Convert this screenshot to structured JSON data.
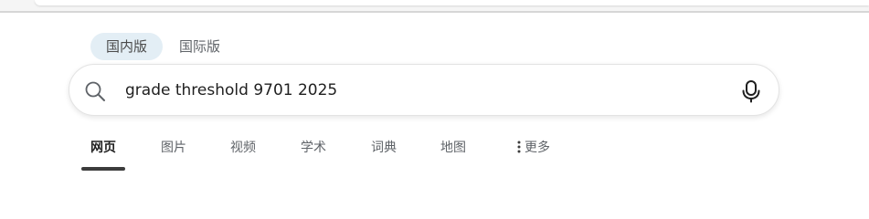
{
  "region_tabs": {
    "domestic_label": "国内版",
    "international_label": "国际版"
  },
  "search": {
    "value": "grade threshold 9701 2025",
    "placeholder": ""
  },
  "nav": {
    "web_label": "网页",
    "images_label": "图片",
    "videos_label": "视频",
    "academic_label": "学术",
    "dictionary_label": "词典",
    "maps_label": "地图",
    "more_label": "更多"
  },
  "icons": {
    "search": "search-icon",
    "mic": "microphone-icon",
    "more": "more-vertical-icon"
  },
  "colors": {
    "active_region_bg": "#e3eef5",
    "active_tab_underline": "#3c3c3c",
    "tab_text": "#5f6368"
  }
}
